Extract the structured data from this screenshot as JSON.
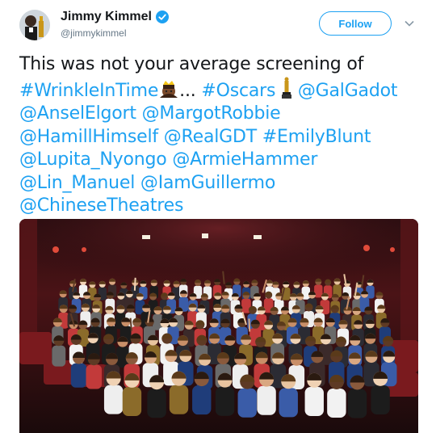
{
  "user": {
    "display_name": "Jimmy Kimmel",
    "handle": "@jimmykimmel",
    "verified": true
  },
  "actions": {
    "follow_label": "Follow"
  },
  "tweet": {
    "segments": [
      {
        "type": "text",
        "text": "This was not your average screening of "
      },
      {
        "type": "link",
        "text": "#WrinkleInTime"
      },
      {
        "type": "emoji",
        "name": "woman-with-crown-emoji"
      },
      {
        "type": "text",
        "text": "... "
      },
      {
        "type": "link",
        "text": "#Oscars"
      },
      {
        "type": "text",
        "text": " "
      },
      {
        "type": "emoji",
        "name": "oscar-statuette-emoji"
      },
      {
        "type": "text",
        "text": " "
      },
      {
        "type": "link",
        "text": "@GalGadot"
      },
      {
        "type": "text",
        "text": " "
      },
      {
        "type": "link",
        "text": "@AnselElgort"
      },
      {
        "type": "text",
        "text": " "
      },
      {
        "type": "link",
        "text": "@MargotRobbie"
      },
      {
        "type": "text",
        "text": " "
      },
      {
        "type": "link",
        "text": "@HamillHimself"
      },
      {
        "type": "text",
        "text": " "
      },
      {
        "type": "link",
        "text": "@RealGDT"
      },
      {
        "type": "text",
        "text": " "
      },
      {
        "type": "link",
        "text": "#EmilyBlunt"
      },
      {
        "type": "text",
        "text": " "
      },
      {
        "type": "link",
        "text": "@Lupita_Nyongo"
      },
      {
        "type": "text",
        "text": " "
      },
      {
        "type": "link",
        "text": "@ArmieHammer"
      },
      {
        "type": "text",
        "text": " "
      },
      {
        "type": "link",
        "text": "@Lin_Manuel"
      },
      {
        "type": "text",
        "text": " "
      },
      {
        "type": "link",
        "text": "@IamGuillermo"
      },
      {
        "type": "text",
        "text": " "
      },
      {
        "type": "link",
        "text": "@ChineseTheatres"
      }
    ]
  },
  "media": {
    "kind": "group-photo-in-theater"
  },
  "colors": {
    "link": "#1da1f2",
    "text": "#14171a",
    "secondary": "#657786"
  }
}
